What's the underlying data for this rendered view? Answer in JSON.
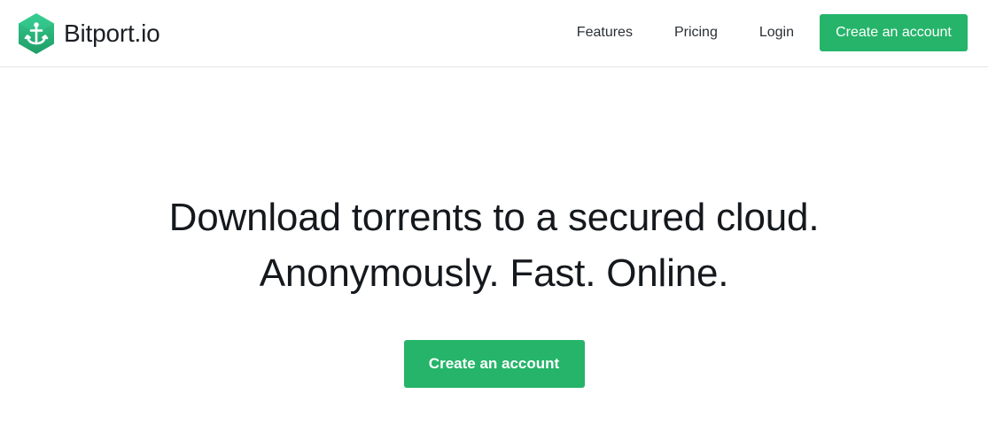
{
  "header": {
    "logo": {
      "brand": "Bitport",
      "tld": ".io",
      "icon": "anchor-hexagon-icon"
    },
    "nav": {
      "features_label": "Features",
      "pricing_label": "Pricing",
      "login_label": "Login",
      "create_account_label": "Create an account"
    }
  },
  "hero": {
    "headline_line1": "Download torrents to a secured cloud.",
    "headline_line2": "Anonymously. Fast. Online.",
    "cta_label": "Create an account"
  },
  "colors": {
    "accent": "#25b46a",
    "logo_gradient_top": "#2fbf86",
    "logo_gradient_bottom": "#1e9b63",
    "text": "#15191d",
    "header_border": "#e4e4e4"
  }
}
